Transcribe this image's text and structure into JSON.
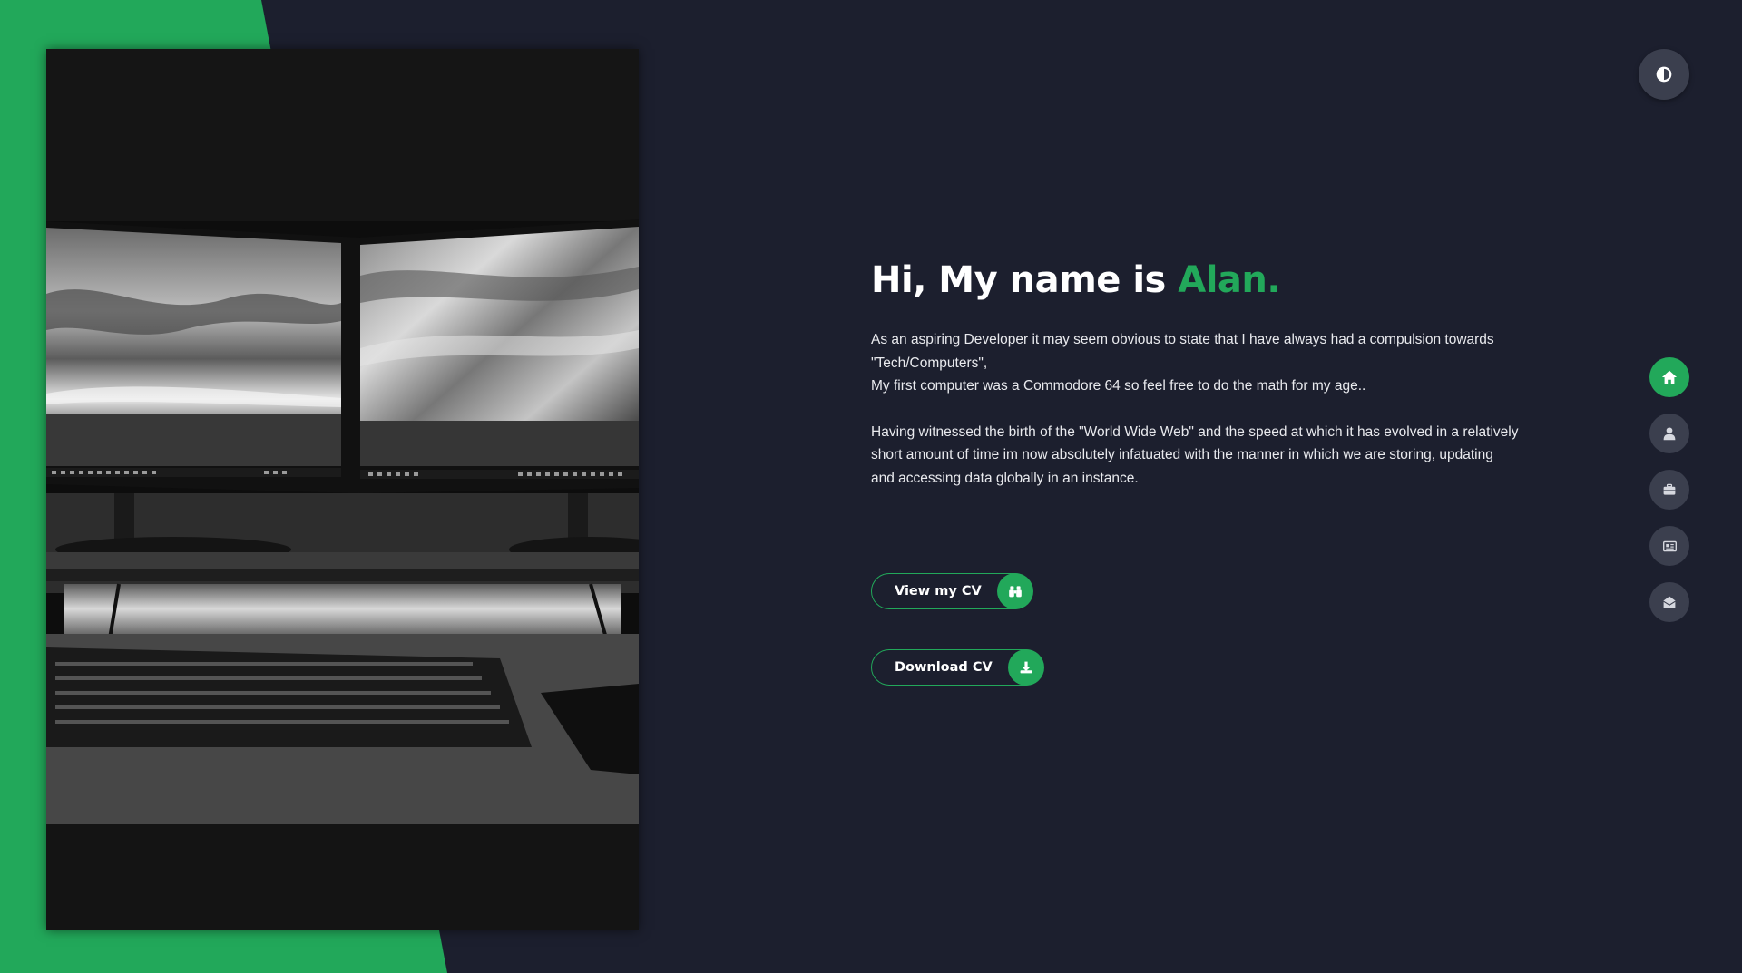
{
  "hero": {
    "greeting": "Hi, My name is ",
    "name": "Alan.",
    "paragraph1_line1": "As an aspiring Developer it may seem obvious to state that I have always had a compulsion towards",
    "paragraph1_line2": "\"Tech/Computers\",",
    "paragraph1_line3": "My first computer was a Commodore 64 so feel free to do the math for my age..",
    "paragraph2_line1": "Having witnessed the birth of the \"World Wide Web\" and the speed at which it has evolved in a relatively",
    "paragraph2_line2": "short amount of time im now absolutely infatuated with the manner in which we are storing, updating",
    "paragraph2_line3": "and accessing data globally in an instance."
  },
  "buttons": {
    "view_cv": {
      "label": "View my CV",
      "icon": "binoculars-icon"
    },
    "download_cv": {
      "label": "Download CV",
      "icon": "download-icon"
    }
  },
  "theme_toggle": {
    "icon": "contrast-icon"
  },
  "nav": [
    {
      "id": "home",
      "icon": "home-icon",
      "active": true
    },
    {
      "id": "about",
      "icon": "user-icon",
      "active": false
    },
    {
      "id": "portfolio",
      "icon": "briefcase-icon",
      "active": false
    },
    {
      "id": "blog",
      "icon": "newspaper-icon",
      "active": false
    },
    {
      "id": "contact",
      "icon": "envelope-open-icon",
      "active": false
    }
  ],
  "colors": {
    "accent": "#22a85a",
    "background": "#1c1f2e",
    "nav_inactive": "#3b3f4e"
  }
}
